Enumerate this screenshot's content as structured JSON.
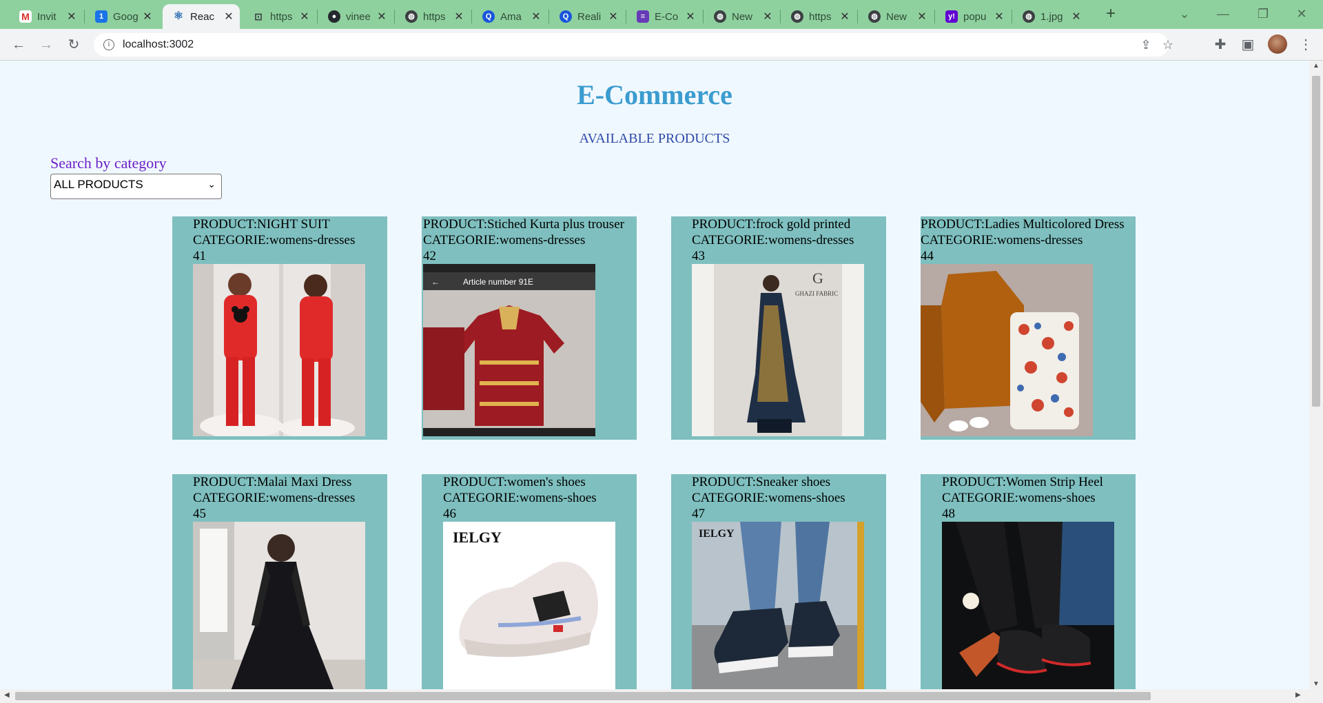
{
  "browser": {
    "tabs": [
      {
        "title": "Invit",
        "icon": "gmail-icon",
        "color": "#d93025"
      },
      {
        "title": "Goog",
        "icon": "google-calendar-icon",
        "color": "#1a73e8"
      },
      {
        "title": "Reac",
        "icon": "react-icon",
        "color": "#2f6fb3",
        "active": true
      },
      {
        "title": "https",
        "icon": "link-icon",
        "color": "#5f6368"
      },
      {
        "title": "vinee",
        "icon": "github-icon",
        "color": "#24292f"
      },
      {
        "title": "https",
        "icon": "globe-icon",
        "color": "#3c4043"
      },
      {
        "title": "Ama",
        "icon": "search-app-icon",
        "color": "#1a56db"
      },
      {
        "title": "Reali",
        "icon": "search-app-icon",
        "color": "#1a56db"
      },
      {
        "title": "E-Co",
        "icon": "forms-icon",
        "color": "#673ab7"
      },
      {
        "title": "New",
        "icon": "globe-icon",
        "color": "#3c4043"
      },
      {
        "title": "https",
        "icon": "globe-icon",
        "color": "#3c4043"
      },
      {
        "title": "New",
        "icon": "globe-icon",
        "color": "#3c4043"
      },
      {
        "title": "popu",
        "icon": "yahoo-icon",
        "color": "#6001d2"
      },
      {
        "title": "1.jpg",
        "icon": "globe-icon",
        "color": "#3c4043"
      }
    ],
    "url": "localhost:3002",
    "theme_color": "#8fd19e"
  },
  "page": {
    "title": "E-Commerce",
    "subtitle": "AVAILABLE PRODUCTS",
    "search_label": "Search by category",
    "category_select": {
      "selected": "ALL PRODUCTS"
    }
  },
  "products": [
    {
      "product": "PRODUCT:NIGHT SUIT",
      "category": "CATEGORIE:womens-dresses",
      "id": "41",
      "image": "red night suit"
    },
    {
      "product": "PRODUCT:Stiched Kurta plus trouser",
      "category": "CATEGORIE:womens-dresses",
      "id": "42",
      "image": "maroon embroidered kurta",
      "image_caption": "Article number 91E"
    },
    {
      "product": "PRODUCT:frock gold printed",
      "category": "CATEGORIE:womens-dresses",
      "id": "43",
      "image": "navy and gold frock",
      "image_caption": "GHAZI FABRIC"
    },
    {
      "product": "PRODUCT:Ladies Multicolored Dress",
      "category": "CATEGORIE:womens-dresses",
      "id": "44",
      "image": "orange top with floral trousers"
    },
    {
      "product": "PRODUCT:Malai Maxi Dress",
      "category": "CATEGORIE:womens-dresses",
      "id": "45",
      "image": "black lace maxi dress"
    },
    {
      "product": "PRODUCT:women's shoes",
      "category": "CATEGORIE:womens-shoes",
      "id": "46",
      "image": "white sneaker",
      "image_caption": "IELGY"
    },
    {
      "product": "PRODUCT:Sneaker shoes",
      "category": "CATEGORIE:womens-shoes",
      "id": "47",
      "image": "black knit sneakers",
      "image_caption": "IELGY"
    },
    {
      "product": "PRODUCT:Women Strip Heel",
      "category": "CATEGORIE:womens-shoes",
      "id": "48",
      "image": "black and red flip flops"
    }
  ],
  "colors": {
    "page_bg": "#f0f8ff",
    "card_bg": "#7fbfbf",
    "title": "#3b9ccf",
    "subtitle": "#2e4aa8",
    "search_label": "#6a20c9"
  }
}
